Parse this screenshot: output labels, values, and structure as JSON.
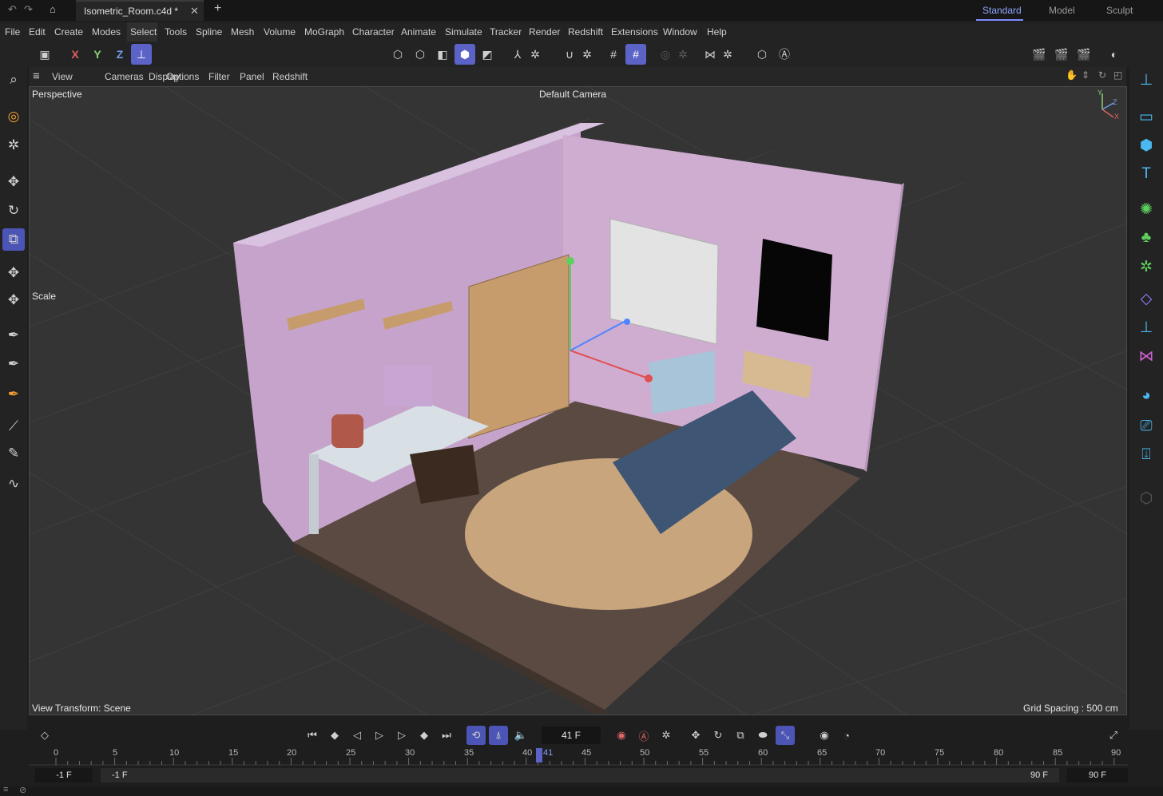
{
  "titlebar": {
    "document_title": "Isometric_Room.c4d *",
    "close_glyph": "✕",
    "new_tab_glyph": "+",
    "undo_icon": "undo-icon",
    "redo_icon": "redo-icon",
    "home_icon": "home-icon",
    "layouts": [
      "Standard",
      "Model",
      "Sculpt"
    ]
  },
  "menubar": {
    "items": [
      "File",
      "Edit",
      "Create",
      "Modes",
      "Select",
      "Tools",
      "Spline",
      "Mesh",
      "Volume",
      "MoGraph",
      "Character",
      "Animate",
      "Simulate",
      "Tracker",
      "Render",
      "Redshift",
      "Extensions",
      "Window",
      "Help"
    ]
  },
  "toolbar": {
    "axis_x": "X",
    "axis_y": "Y",
    "axis_z": "Z"
  },
  "viewport_menu": {
    "items": [
      "View",
      "Cameras",
      "Display",
      "Options",
      "Filter",
      "Panel",
      "Redshift"
    ]
  },
  "viewport": {
    "view_name": "Perspective",
    "camera_name": "Default Camera",
    "active_tool": "Scale",
    "view_transform": "View Transform: Scene",
    "grid_spacing": "Grid Spacing : 500 cm",
    "gizmo_axes": {
      "x": "X",
      "y": "Y",
      "z": "Z"
    }
  },
  "timeline": {
    "current_frame": "41 F",
    "ruler_ticks": [
      "0",
      "5",
      "10",
      "15",
      "20",
      "25",
      "30",
      "35",
      "40",
      "45",
      "50",
      "55",
      "60",
      "65",
      "70",
      "75",
      "80",
      "85",
      "90"
    ],
    "playhead_label": "41",
    "range_start": "-1 F",
    "range_start_inner": "-1 F",
    "range_end_inner": "90 F",
    "range_end": "90 F"
  },
  "colors": {
    "accent": "#5b63c6",
    "wall": "#c9a8cc",
    "floor": "#5a4a42",
    "rug": "#c9a57e",
    "blanket": "#3e5573"
  }
}
